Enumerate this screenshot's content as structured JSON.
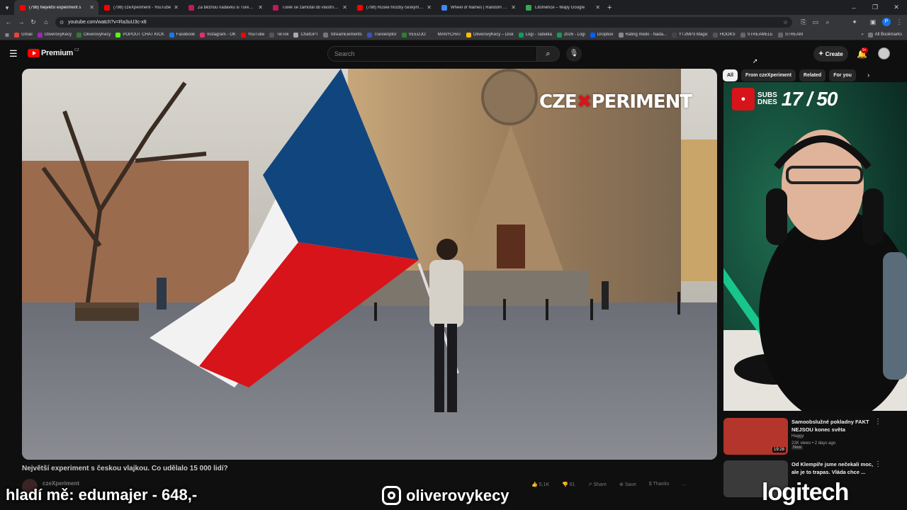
{
  "browser": {
    "tabs": [
      {
        "title": "(798) Největší experiment s",
        "color": "#ff0000",
        "active": true
      },
      {
        "title": "(798) czeXperiment - YouTube",
        "color": "#ff0000"
      },
      {
        "title": "Za běžnou nadávku si Turek vy",
        "color": "#c2185b"
      },
      {
        "title": "Turek se zamotal do vlastních l",
        "color": "#c2185b"
      },
      {
        "title": "(798) Ruské hrozby českým zbr",
        "color": "#ff0000"
      },
      {
        "title": "Wheel of Names | Random nam",
        "color": "#4285f4"
      },
      {
        "title": "Litoměřice – Mapy Google",
        "color": "#34a853"
      }
    ],
    "new_tab": "+",
    "url": "youtube.com/watch?v=Ra3uU3c-x8",
    "bookmarks": [
      {
        "label": "Gmail",
        "color": "#ea4335"
      },
      {
        "label": "OliverovyKecy",
        "color": "#9c27b0"
      },
      {
        "label": "OliverovyKecy",
        "color": "#2e7d32"
      },
      {
        "label": "POPOUT CHAT KICK",
        "color": "#53fc18"
      },
      {
        "label": "Facebook",
        "color": "#1877f2"
      },
      {
        "label": "Instagram - OK",
        "color": "#e1306c"
      },
      {
        "label": "YouTube",
        "color": "#ff0000"
      },
      {
        "label": "TikTok",
        "color": "#555555"
      },
      {
        "label": "ChatGPT",
        "color": "#aaaaaa"
      },
      {
        "label": "StreamElements",
        "color": "#777777"
      },
      {
        "label": "Transkriptor",
        "color": "#3f51b5"
      },
      {
        "label": "VEEDJO",
        "color": "#2e7d32"
      },
      {
        "label": "MANYCHAT",
        "color": "#333333"
      },
      {
        "label": "OliverovyKecy – Disk",
        "color": "#fbbc04"
      },
      {
        "label": "Logi - Tabulka",
        "color": "#0f9d58"
      },
      {
        "label": "2026 - Logi",
        "color": "#0f9d58"
      },
      {
        "label": "Dropbox",
        "color": "#0061ff"
      },
      {
        "label": "Rating médií - Nada...",
        "color": "#888888"
      },
      {
        "label": "YT2MP3 Magic",
        "color": "#444444"
      },
      {
        "label": "HOOKS",
        "color": "#555555"
      },
      {
        "label": "STREAMELE",
        "color": "#666666"
      },
      {
        "label": "STREAM",
        "color": "#666666"
      }
    ],
    "all_bookmarks": "All Bookmarks"
  },
  "youtube": {
    "logo": "Premium",
    "region": "CZ",
    "search_placeholder": "Search",
    "create_label": "Create",
    "notif_count": "9+",
    "chips": [
      "All",
      "From czeXperiment",
      "Related",
      "For you"
    ],
    "video_watermark_a": "CZE",
    "video_watermark_b": "PERIMENT",
    "video_title": "Největší experiment s českou vlajkou. Co udělalo 15 000 lidí?",
    "channel": "czeXperiment",
    "actions": [
      "5,1K",
      "61",
      "Share",
      "Save",
      "Thanks",
      "..."
    ],
    "subs_label_1": "SUBS",
    "subs_label_2": "DNES",
    "subs_count": "17 / 50",
    "related": [
      {
        "title": "Samoobslužné pokladny FAKT NEJSOU konec světa",
        "channel": "Haggy",
        "meta": "22K views • 2 days ago",
        "badge": "New",
        "duration": "19:28"
      },
      {
        "title": "Od Klempíře jsme nečekali moc, ale je to trapas. Vláda chce ...",
        "channel": "",
        "meta": "",
        "badge": "",
        "duration": ""
      }
    ]
  },
  "overlay": {
    "left_text": "hladí mě: edumajer - 648,-",
    "center_text": "oliverovykecy",
    "right_text": "logitech"
  },
  "colors": {
    "yt_red": "#ff0000",
    "cz_blue": "#11457e",
    "cz_red": "#d7141a",
    "neon_green": "#19e3a1"
  }
}
